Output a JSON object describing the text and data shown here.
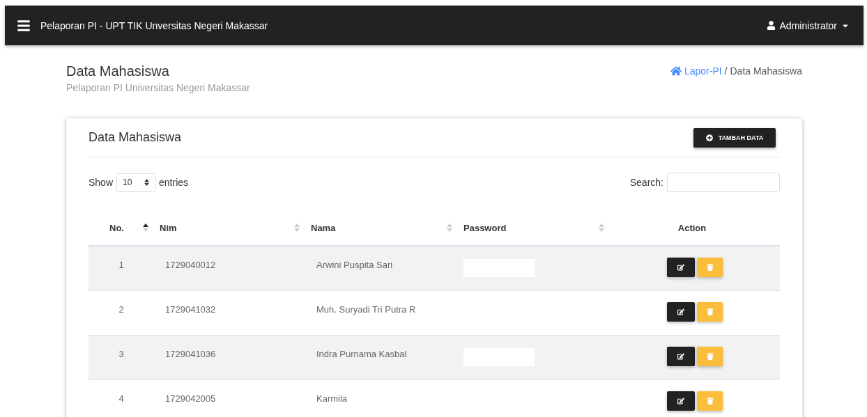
{
  "navbar": {
    "title": "Pelaporan PI - UPT TIK Unversitas Negeri Makassar",
    "user": "Administrator"
  },
  "page": {
    "title": "Data Mahasiswa",
    "subtitle": "Pelaporan PI Universitas Negeri Makassar"
  },
  "breadcrumb": {
    "home": "Lapor-PI",
    "separator": "/",
    "current": "Data Mahasiswa"
  },
  "card": {
    "title": "Data Mahasiswa",
    "add_button": "TAMBAH DATA"
  },
  "length": {
    "show": "Show",
    "value": "10",
    "entries": "entries"
  },
  "search": {
    "label": "Search:"
  },
  "table": {
    "columns": [
      {
        "label": "No.",
        "sortable": true,
        "sorted": true
      },
      {
        "label": "Nim",
        "sortable": true,
        "sorted": false
      },
      {
        "label": "Nama",
        "sortable": true,
        "sorted": false
      },
      {
        "label": "Password",
        "sortable": true,
        "sorted": false
      },
      {
        "label": "Action",
        "sortable": false
      }
    ],
    "rows": [
      {
        "no": "1",
        "nim": "1729040012",
        "nama": "Arwini Puspita Sari"
      },
      {
        "no": "2",
        "nim": "1729041032",
        "nama": "Muh. Suryadi Tri Putra R"
      },
      {
        "no": "3",
        "nim": "1729041036",
        "nama": "Indra Purnama Kasbal"
      },
      {
        "no": "4",
        "nim": "1729042005",
        "nama": "Karmila"
      }
    ]
  }
}
